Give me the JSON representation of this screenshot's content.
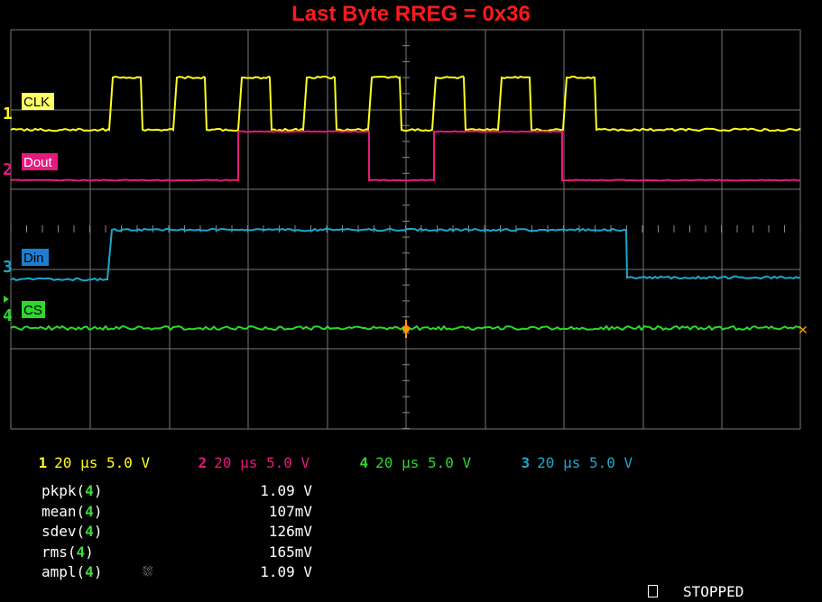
{
  "title": "Last Byte RREG = 0x36",
  "channels": [
    {
      "num": "1",
      "label": "CLK",
      "color": "#ffff1a",
      "label_bg": "#ffff66",
      "label_fg": "#000000",
      "setting": "20 µs 5.0 V"
    },
    {
      "num": "2",
      "label": "Dout",
      "color": "#e6197d",
      "label_bg": "#e6197d",
      "label_fg": "#ffffff",
      "setting": "20 µs 5.0 V"
    },
    {
      "num": "4",
      "label": "CS",
      "color": "#2ed62e",
      "label_bg": "#2ed62e",
      "label_fg": "#000000",
      "setting": "20 µs 5.0 V"
    },
    {
      "num": "3",
      "label": "Din",
      "color": "#1ea6c8",
      "label_bg": "#1e7fd0",
      "label_fg": "#000000",
      "setting": "20 µs 5.0 V"
    }
  ],
  "measurements": [
    {
      "name": "pkpk(",
      "ch": "4",
      "close": ")",
      "value": "1.09 V",
      "extra": ""
    },
    {
      "name": "mean(",
      "ch": "4",
      "close": ")",
      "value": "107mV",
      "extra": ""
    },
    {
      "name": "sdev(",
      "ch": "4",
      "close": ")",
      "value": "126mV",
      "extra": ""
    },
    {
      "name": "rms(",
      "ch": "4",
      "close": ")",
      "value": "165mV",
      "extra": ""
    },
    {
      "name": "ampl(",
      "ch": "4",
      "close": ")",
      "value": "1.09 V",
      "extra": "⛆"
    }
  ],
  "status": "STOPPED",
  "trigger_marker_color": "#ff9900"
}
